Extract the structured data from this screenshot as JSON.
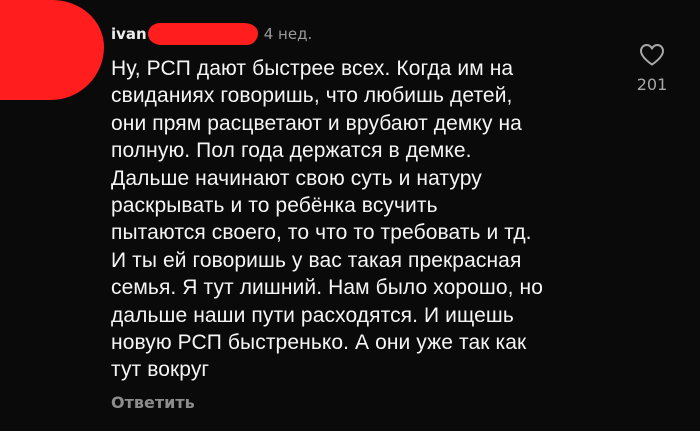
{
  "comment": {
    "username": "ivan",
    "time": "4 нед.",
    "text": "Ну, РСП дают быстрее всех. Когда им на\nсвиданиях говоришь, что любишь детей,\nони прям расцветают и врубают демку на\nполную. Пол года держатся в демке.\nДальше начинают свою суть и натуру\nраскрывать и то ребёнка всучить\nпытаются своего, то что то требовать и тд.\nИ ты ей говоришь у вас такая прекрасная\nсемья. Я тут лишний. Нам было хорошо, но\nдальше наши пути расходятся. И ищешь\nновую РСП быстренько. А они уже так как\nтут вокруг",
    "reply_label": "Ответить",
    "like_count": "201",
    "like_icon": "heart-outline-icon"
  },
  "colors": {
    "background": "#0a0a0a",
    "redaction": "#ff1d1d",
    "text": "#f5f5f5",
    "muted": "#9a9a9a"
  }
}
